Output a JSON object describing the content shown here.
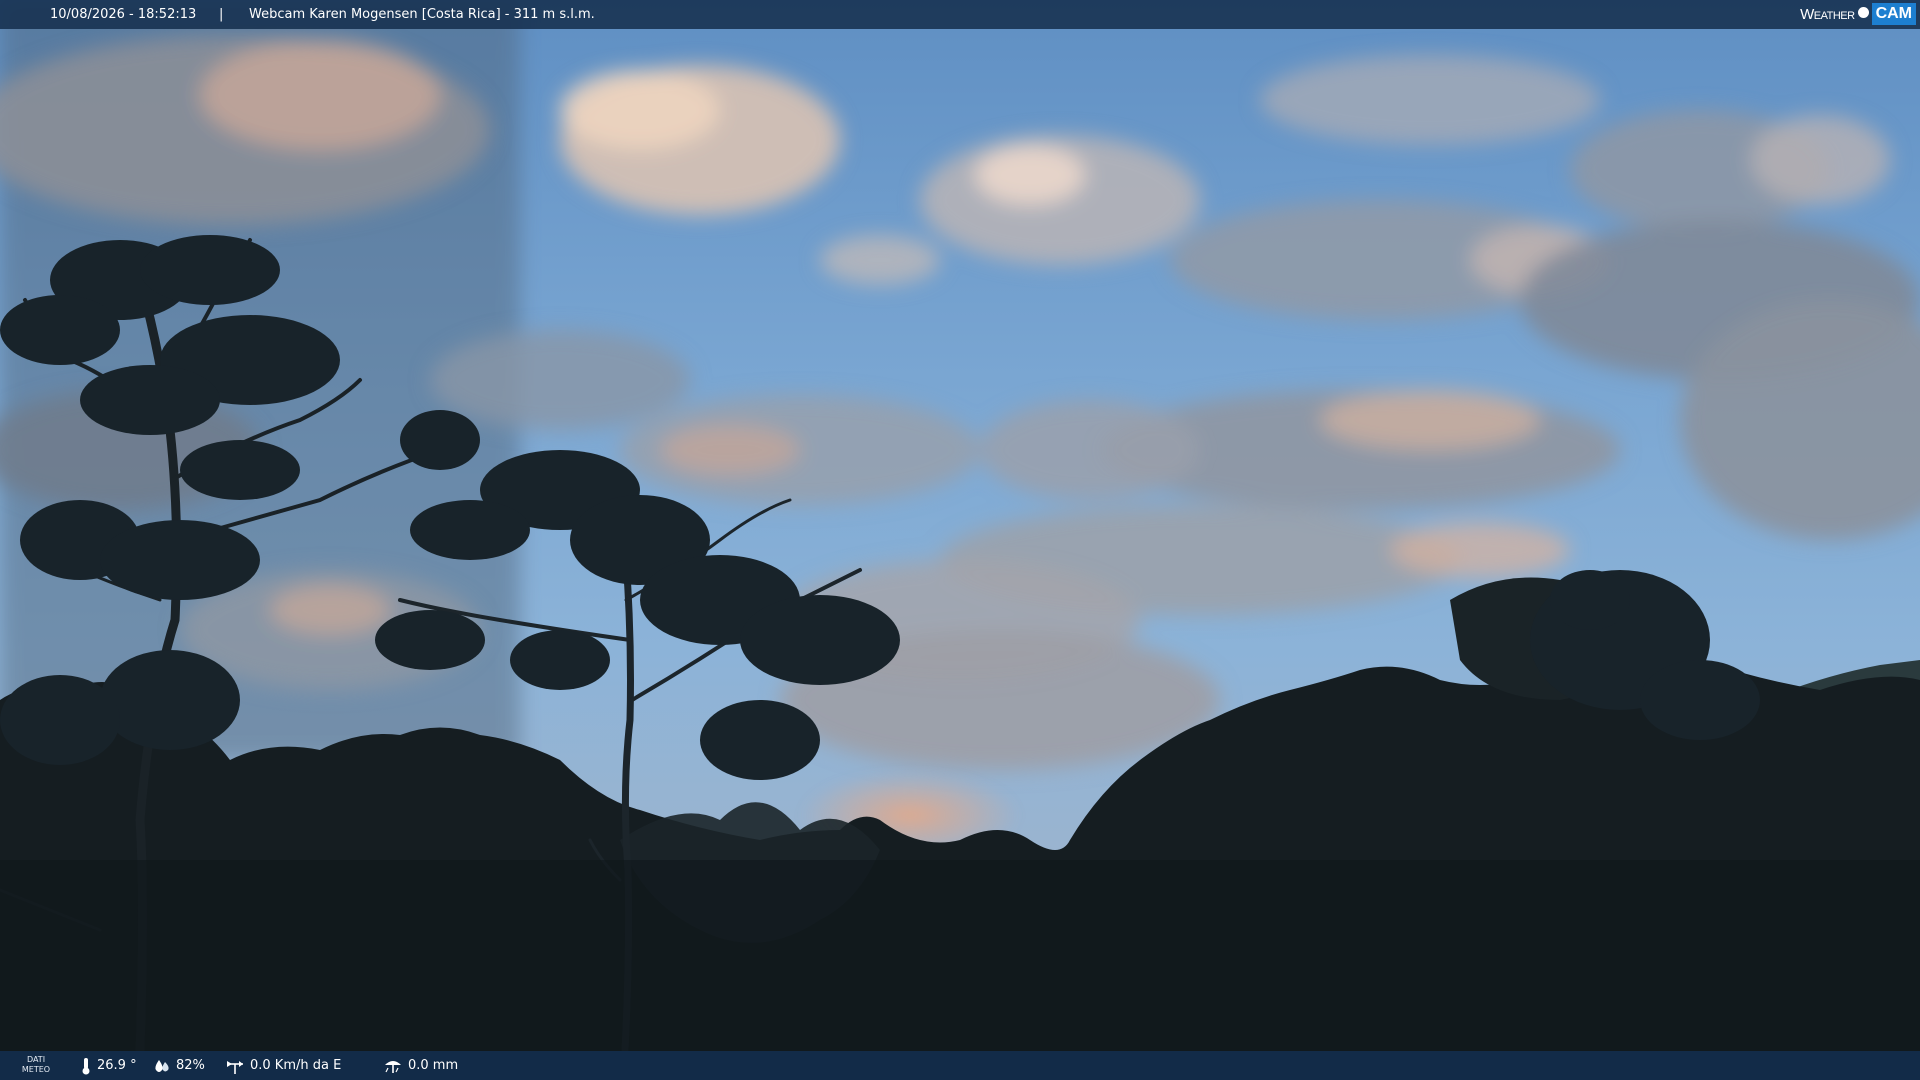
{
  "header": {
    "datetime": "10/08/2026 - 18:52:13",
    "separator": "|",
    "camera_title": "Webcam Karen Mogensen [Costa Rica] - 311 m s.l.m."
  },
  "brand": {
    "word": "Weather",
    "cam": "CAM"
  },
  "weather": {
    "section_label_1": "DATI",
    "section_label_2": "METEO",
    "temperature": "26.9 °",
    "humidity": "82%",
    "wind": "0.0 Km/h da E",
    "rain": "0.0 mm"
  },
  "icons": {
    "temperature": "thermometer-icon",
    "humidity": "humidity-drops-icon",
    "wind": "wind-vane-icon",
    "rain": "rain-gauge-icon"
  },
  "colors": {
    "bar_background": "#16304e",
    "brand_accent": "#1d7fd0",
    "sky": "#7ea8cf",
    "foliage": "#141d22"
  }
}
